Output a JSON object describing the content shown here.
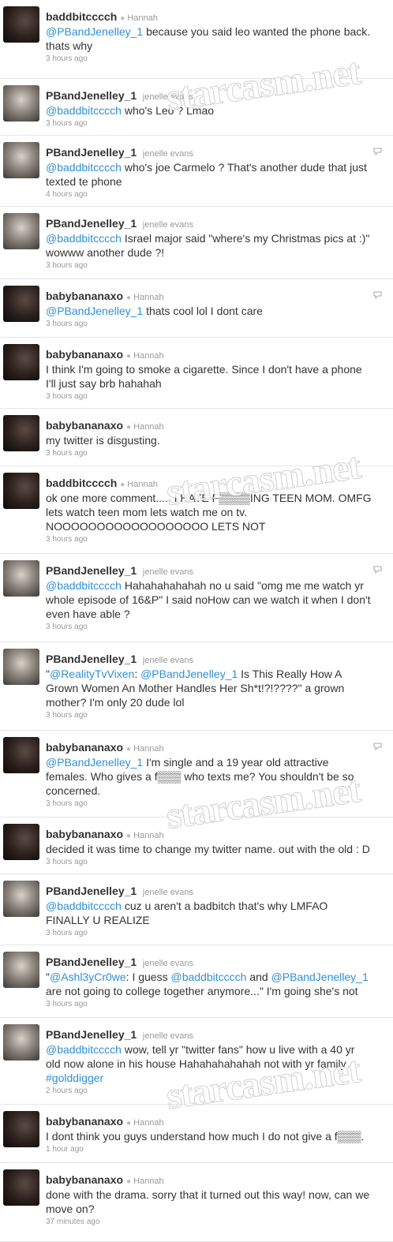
{
  "watermark_text": "starcasm.net",
  "separator": "●",
  "tweets": [
    {
      "user": "baddbitcccch",
      "name": "Hannah",
      "dot": true,
      "avatar": "dark",
      "mention": "@PBandJenelley_1",
      "lines": [
        " because you said leo wanted the phone back.",
        "thats why"
      ],
      "time": "3 hours ago",
      "reply": false
    },
    {
      "user": "PBandJenelley_1",
      "name": "jenelle evans",
      "dot": false,
      "avatar": "light",
      "mention": "@baddbitcccch",
      "lines": [
        " who's Leo ? Lmao"
      ],
      "time": "3 hours ago",
      "reply": false
    },
    {
      "user": "PBandJenelley_1",
      "name": "jenelle evans",
      "dot": false,
      "avatar": "light",
      "mention": "@baddbitcccch",
      "lines": [
        " who's joe Carmelo ? That's another dude that just",
        "texted te phone"
      ],
      "time": "4 hours ago",
      "reply": true
    },
    {
      "user": "PBandJenelley_1",
      "name": "jenelle evans",
      "dot": false,
      "avatar": "light",
      "mention": "@baddbitcccch",
      "lines": [
        " Israel major said \"where's my Christmas pics at :)\"",
        "wowww another dude ?!"
      ],
      "time": "3 hours ago",
      "reply": false
    },
    {
      "user": "babybananaxo",
      "name": "Hannah",
      "dot": true,
      "avatar": "dark",
      "mention": "@PBandJenelley_1",
      "lines": [
        " thats cool lol I dont care"
      ],
      "time": "3 hours ago",
      "reply": true
    },
    {
      "user": "babybananaxo",
      "name": "Hannah",
      "dot": true,
      "avatar": "dark",
      "mention": "",
      "lines": [
        "I think I'm going to smoke a cigarette. Since I don't have a phone",
        "I'll just say brb hahahah"
      ],
      "time": "3 hours ago",
      "reply": false
    },
    {
      "user": "babybananaxo",
      "name": "Hannah",
      "dot": true,
      "avatar": "dark",
      "mention": "",
      "lines": [
        "my twitter is disgusting."
      ],
      "time": "3 hours ago",
      "reply": false
    },
    {
      "user": "baddbitcccch",
      "name": "Hannah",
      "dot": true,
      "avatar": "dark",
      "mention": "",
      "lines": [
        "ok one more comment..... I HATE F▒▒▒▒ING TEEN MOM. OMFG",
        "lets watch teen mom lets watch me on tv.",
        "NOOOOOOOOOOOOOOOOOO LETS NOT"
      ],
      "time": "3 hours ago",
      "reply": false
    },
    {
      "user": "PBandJenelley_1",
      "name": "jenelle evans",
      "dot": false,
      "avatar": "light",
      "mention": "@baddbitcccch",
      "lines": [
        " Hahahahahahah no u said \"omg me me watch yr",
        "whole episode of 16&P\" I said noHow can we watch it when I don't",
        "even have able ?"
      ],
      "time": "3 hours ago",
      "reply": true
    },
    {
      "user": "PBandJenelley_1",
      "name": "jenelle evans",
      "dot": false,
      "avatar": "light",
      "mention": "",
      "lines": [
        "\"@RealityTvVixen: @PBandJenelley_1 Is This Really How A",
        "Grown Women An Mother Handles Her Sh*t!?!????\" a grown",
        "mother? I'm only 20 dude lol"
      ],
      "time": "3 hours ago",
      "reply": false
    },
    {
      "user": "babybananaxo",
      "name": "Hannah",
      "dot": true,
      "avatar": "dark",
      "mention": "@PBandJenelley_1",
      "lines": [
        " I'm single and a 19 year old attractive",
        "females. Who gives a f▒▒▒ who texts me? You shouldn't be so",
        "concerned."
      ],
      "time": "3 hours ago",
      "reply": true
    },
    {
      "user": "babybananaxo",
      "name": "Hannah",
      "dot": true,
      "avatar": "dark",
      "mention": "",
      "lines": [
        "decided it was time to change my twitter name. out with the old : D"
      ],
      "time": "3 hours ago",
      "reply": false
    },
    {
      "user": "PBandJenelley_1",
      "name": "jenelle evans",
      "dot": false,
      "avatar": "light",
      "mention": "@baddbitcccch",
      "lines": [
        " cuz u aren't a badbitch that's why LMFAO",
        "FINALLY U REALIZE"
      ],
      "time": "3 hours ago",
      "reply": false
    },
    {
      "user": "PBandJenelley_1",
      "name": "jenelle evans",
      "dot": false,
      "avatar": "light",
      "mention": "",
      "lines": [
        "\"@Ashl3yCr0we: I guess @baddbitcccch and @PBandJenelley_1",
        "are not going to college together anymore...\" I'm going she's not"
      ],
      "time": "3 hours ago",
      "reply": false
    },
    {
      "user": "PBandJenelley_1",
      "name": "jenelle evans",
      "dot": false,
      "avatar": "light",
      "mention": "@baddbitcccch",
      "lines": [
        " wow, tell yr \"twitter fans\" how u live with a 40 yr",
        "old now alone in his house Hahahahahahah not with yr family",
        "#golddigger"
      ],
      "time": "2 hours ago",
      "reply": false
    },
    {
      "user": "babybananaxo",
      "name": "Hannah",
      "dot": true,
      "avatar": "dark",
      "mention": "",
      "lines": [
        "I dont think you guys understand how much I do not give a f▒▒▒."
      ],
      "time": "1 hour ago",
      "reply": false
    },
    {
      "user": "babybananaxo",
      "name": "Hannah",
      "dot": true,
      "avatar": "dark",
      "mention": "",
      "lines": [
        "done with the drama. sorry that it turned out this way! now, can we",
        "move on?"
      ],
      "time": "37 minutes ago",
      "reply": false
    }
  ]
}
